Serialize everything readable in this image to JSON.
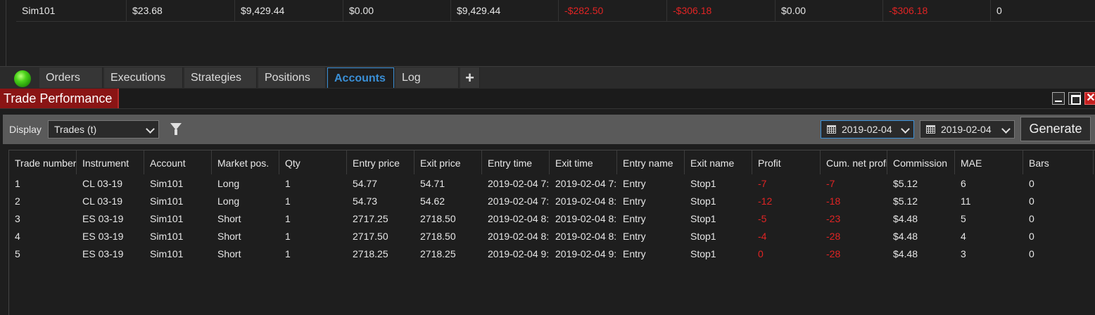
{
  "account_row": [
    "Sim101",
    "$23.68",
    "$9,429.44",
    "$0.00",
    "$9,429.44",
    "-$282.50",
    "-$306.18",
    "$0.00",
    "-$306.18",
    "0"
  ],
  "account_row_negative": [
    false,
    false,
    false,
    false,
    false,
    true,
    true,
    false,
    true,
    false
  ],
  "tabs": [
    "Orders",
    "Executions",
    "Strategies",
    "Positions",
    "Accounts",
    "Log",
    "+"
  ],
  "active_tab": "Accounts",
  "window": {
    "title": "Trade Performance",
    "close_glyph": "✕"
  },
  "toolbar": {
    "display_label": "Display",
    "display_value": "Trades (t)",
    "date_from": "2019-02-04",
    "date_to": "2019-02-04",
    "generate_label": "Generate"
  },
  "grid": {
    "columns": [
      "Trade number",
      "Instrument",
      "Account",
      "Market pos.",
      "Qty",
      "Entry price",
      "Exit price",
      "Entry time",
      "Exit time",
      "Entry name",
      "Exit name",
      "Profit",
      "Cum. net profit",
      "Commission",
      "MAE",
      "Bars"
    ],
    "rows": [
      [
        "1",
        "CL 03-19",
        "Sim101",
        "Long",
        "1",
        "54.77",
        "54.71",
        "2019-02-04 7:",
        "2019-02-04 7:",
        "Entry",
        "Stop1",
        "-7",
        "-7",
        "$5.12",
        "6",
        "0"
      ],
      [
        "2",
        "CL 03-19",
        "Sim101",
        "Long",
        "1",
        "54.73",
        "54.62",
        "2019-02-04 7:",
        "2019-02-04 8:",
        "Entry",
        "Stop1",
        "-12",
        "-18",
        "$5.12",
        "11",
        "0"
      ],
      [
        "3",
        "ES 03-19",
        "Sim101",
        "Short",
        "1",
        "2717.25",
        "2718.50",
        "2019-02-04 8:",
        "2019-02-04 8:",
        "Entry",
        "Stop1",
        "-5",
        "-23",
        "$4.48",
        "5",
        "0"
      ],
      [
        "4",
        "ES 03-19",
        "Sim101",
        "Short",
        "1",
        "2717.50",
        "2718.50",
        "2019-02-04 8:",
        "2019-02-04 8:",
        "Entry",
        "Stop1",
        "-4",
        "-28",
        "$4.48",
        "4",
        "0"
      ],
      [
        "5",
        "ES 03-19",
        "Sim101",
        "Short",
        "1",
        "2718.25",
        "2718.25",
        "2019-02-04 9:",
        "2019-02-04 9:",
        "Entry",
        "Stop1",
        "0",
        "-28",
        "$4.48",
        "3",
        "0"
      ]
    ],
    "red_columns": [
      11,
      12
    ]
  },
  "colors": {
    "negative": "#e02424",
    "accent": "#3a8fd6",
    "title_bg": "#8a1515"
  }
}
